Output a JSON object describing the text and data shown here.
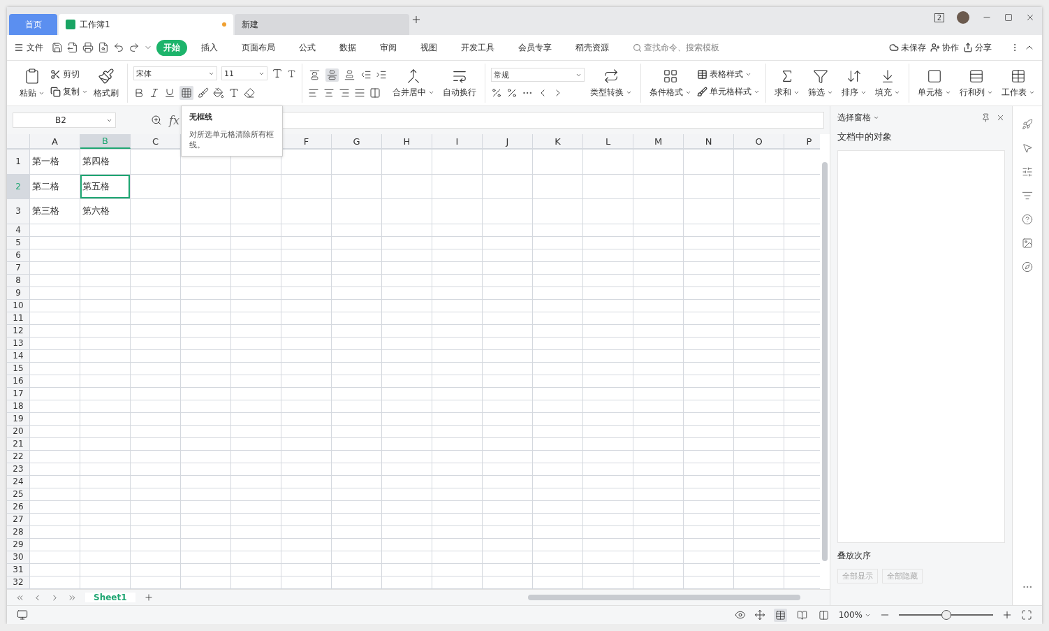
{
  "title_tabs": [
    {
      "label": "首页",
      "kind": "home",
      "selected": false,
      "modified": false
    },
    {
      "label": "工作簿1",
      "kind": "doc",
      "selected": true,
      "modified": true
    },
    {
      "label": "新建",
      "kind": "new",
      "selected": false,
      "modified": false
    }
  ],
  "window_badge": "2",
  "menu": {
    "file": "文件",
    "tabs": [
      {
        "label": "开始",
        "selected": true
      },
      {
        "label": "插入",
        "selected": false
      },
      {
        "label": "页面布局",
        "selected": false
      },
      {
        "label": "公式",
        "selected": false
      },
      {
        "label": "数据",
        "selected": false
      },
      {
        "label": "审阅",
        "selected": false
      },
      {
        "label": "视图",
        "selected": false
      },
      {
        "label": "开发工具",
        "selected": false
      },
      {
        "label": "会员专享",
        "selected": false
      },
      {
        "label": "稻壳资源",
        "selected": false
      }
    ],
    "search": {
      "placeholder": "查找命令、搜索模板"
    },
    "save_state": "未保存",
    "collab": "协作",
    "share": "分享"
  },
  "ribbon": {
    "paste": "粘贴",
    "cut": "剪切",
    "copy": "复制",
    "painter": "格式刷",
    "font_name": "宋体",
    "font_size": "11",
    "border_active": true,
    "valign": [
      {
        "selected": false
      },
      {
        "selected": true
      },
      {
        "selected": false
      }
    ],
    "merge": "合并居中",
    "wrap": "自动换行",
    "number_format": "常规",
    "convert": "类型转换",
    "cond_format": "条件格式",
    "table_style": "表格样式",
    "cell_style": "单元格样式",
    "tools": [
      {
        "label": "求和",
        "kind": "sum"
      },
      {
        "label": "筛选",
        "kind": "filter"
      },
      {
        "label": "排序",
        "kind": "sort"
      },
      {
        "label": "填充",
        "kind": "fill"
      }
    ],
    "cells": [
      {
        "label": "单元格",
        "kind": "cell"
      },
      {
        "label": "行和列",
        "kind": "rowcol"
      },
      {
        "label": "工作表",
        "kind": "sheet"
      }
    ]
  },
  "formula_bar": {
    "name_box": "B2",
    "fx": "fx"
  },
  "tooltip": {
    "title": "无框线",
    "text": "对所选单元格清除所有框线。"
  },
  "columns": [
    {
      "label": "A",
      "selected": false
    },
    {
      "label": "B",
      "selected": true
    },
    {
      "label": "C",
      "selected": false
    },
    {},
    {},
    {
      "label": "F",
      "selected": false
    },
    {
      "label": "G",
      "selected": false
    },
    {
      "label": "H",
      "selected": false
    },
    {
      "label": "I",
      "selected": false
    },
    {
      "label": "J",
      "selected": false
    },
    {
      "label": "K",
      "selected": false
    },
    {
      "label": "L",
      "selected": false
    },
    {
      "label": "M",
      "selected": false
    },
    {
      "label": "N",
      "selected": false
    },
    {
      "label": "O",
      "selected": false
    },
    {
      "label": "P",
      "selected": false
    }
  ],
  "rows": [
    {
      "label": "1",
      "selected": false,
      "tall": true,
      "cells": [
        {
          "text": "第一格",
          "selected": false
        },
        {
          "text": "第四格",
          "selected": false
        }
      ]
    },
    {
      "label": "2",
      "selected": true,
      "tall": true,
      "cells": [
        {
          "text": "第二格",
          "selected": false
        },
        {
          "text": "第五格",
          "selected": true
        }
      ]
    },
    {
      "label": "3",
      "selected": false,
      "tall": true,
      "cells": [
        {
          "text": "第三格",
          "selected": false
        },
        {
          "text": "第六格",
          "selected": false
        }
      ]
    },
    {
      "label": "4",
      "selected": false,
      "tall": false
    },
    {
      "label": "5",
      "selected": false,
      "tall": false
    },
    {
      "label": "6",
      "selected": false,
      "tall": false
    },
    {
      "label": "7",
      "selected": false,
      "tall": false
    },
    {
      "label": "8",
      "selected": false,
      "tall": false
    },
    {
      "label": "9",
      "selected": false,
      "tall": false
    },
    {
      "label": "10",
      "selected": false,
      "tall": false
    },
    {
      "label": "11",
      "selected": false,
      "tall": false
    },
    {
      "label": "12",
      "selected": false,
      "tall": false
    },
    {
      "label": "13",
      "selected": false,
      "tall": false
    },
    {
      "label": "14",
      "selected": false,
      "tall": false
    },
    {
      "label": "15",
      "selected": false,
      "tall": false
    },
    {
      "label": "16",
      "selected": false,
      "tall": false
    },
    {
      "label": "17",
      "selected": false,
      "tall": false
    },
    {
      "label": "18",
      "selected": false,
      "tall": false
    },
    {
      "label": "19",
      "selected": false,
      "tall": false
    },
    {
      "label": "20",
      "selected": false,
      "tall": false
    },
    {
      "label": "21",
      "selected": false,
      "tall": false
    },
    {
      "label": "22",
      "selected": false,
      "tall": false
    },
    {
      "label": "23",
      "selected": false,
      "tall": false
    },
    {
      "label": "24",
      "selected": false,
      "tall": false
    },
    {
      "label": "25",
      "selected": false,
      "tall": false
    },
    {
      "label": "26",
      "selected": false,
      "tall": false
    },
    {
      "label": "27",
      "selected": false,
      "tall": false
    },
    {
      "label": "28",
      "selected": false,
      "tall": false
    },
    {
      "label": "29",
      "selected": false,
      "tall": false
    },
    {
      "label": "30",
      "selected": false,
      "tall": false
    },
    {
      "label": "31",
      "selected": false,
      "tall": false
    },
    {
      "label": "32",
      "selected": false,
      "tall": false
    }
  ],
  "selection_pane": {
    "title": "选择窗格",
    "heading": "文档中的对象",
    "order_label": "叠放次序",
    "buttons": [
      {
        "label": "全部显示",
        "disabled": true
      },
      {
        "label": "全部隐藏",
        "disabled": true
      }
    ]
  },
  "sheet_tabs": [
    {
      "label": "Sheet1",
      "selected": true
    }
  ],
  "status_bar": {
    "zoom": "100%",
    "zoom_slider": {
      "level": 0.5
    },
    "views": [
      {
        "selected": true
      },
      {
        "selected": false
      },
      {
        "selected": false
      }
    ]
  }
}
